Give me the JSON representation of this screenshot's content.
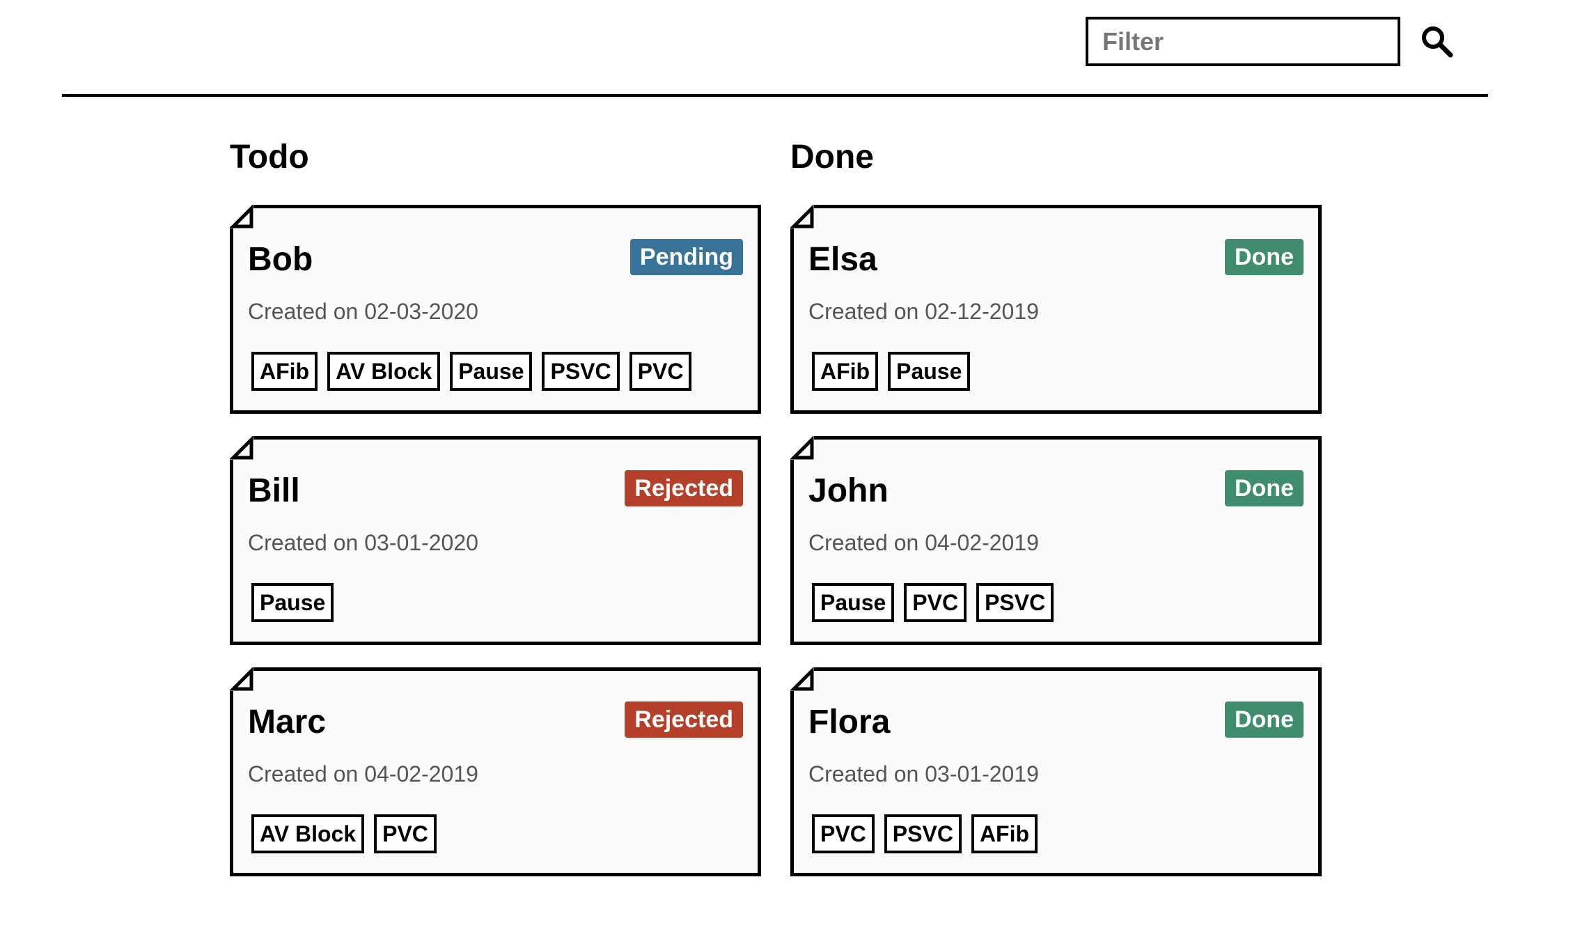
{
  "header": {
    "filter_placeholder": "Filter",
    "filter_value": "",
    "search_icon": "search-icon"
  },
  "columns": [
    {
      "title": "Todo",
      "cards": [
        {
          "name": "Bob",
          "status": "Pending",
          "status_type": "pending",
          "date": "Created on 02-03-2020",
          "tags": [
            "AFib",
            "AV Block",
            "Pause",
            "PSVC",
            "PVC"
          ]
        },
        {
          "name": "Bill",
          "status": "Rejected",
          "status_type": "rejected",
          "date": "Created on 03-01-2020",
          "tags": [
            "Pause"
          ]
        },
        {
          "name": "Marc",
          "status": "Rejected",
          "status_type": "rejected",
          "date": "Created on 04-02-2019",
          "tags": [
            "AV Block",
            "PVC"
          ]
        }
      ]
    },
    {
      "title": "Done",
      "cards": [
        {
          "name": "Elsa",
          "status": "Done",
          "status_type": "done",
          "date": "Created on 02-12-2019",
          "tags": [
            "AFib",
            "Pause"
          ]
        },
        {
          "name": "John",
          "status": "Done",
          "status_type": "done",
          "date": "Created on 04-02-2019",
          "tags": [
            "Pause",
            "PVC",
            "PSVC"
          ]
        },
        {
          "name": "Flora",
          "status": "Done",
          "status_type": "done",
          "date": "Created on 03-01-2019",
          "tags": [
            "PVC",
            "PSVC",
            "AFib"
          ]
        }
      ]
    }
  ],
  "colors": {
    "pending": "#3a739a",
    "rejected": "#b4402a",
    "done": "#3f8c6e"
  }
}
